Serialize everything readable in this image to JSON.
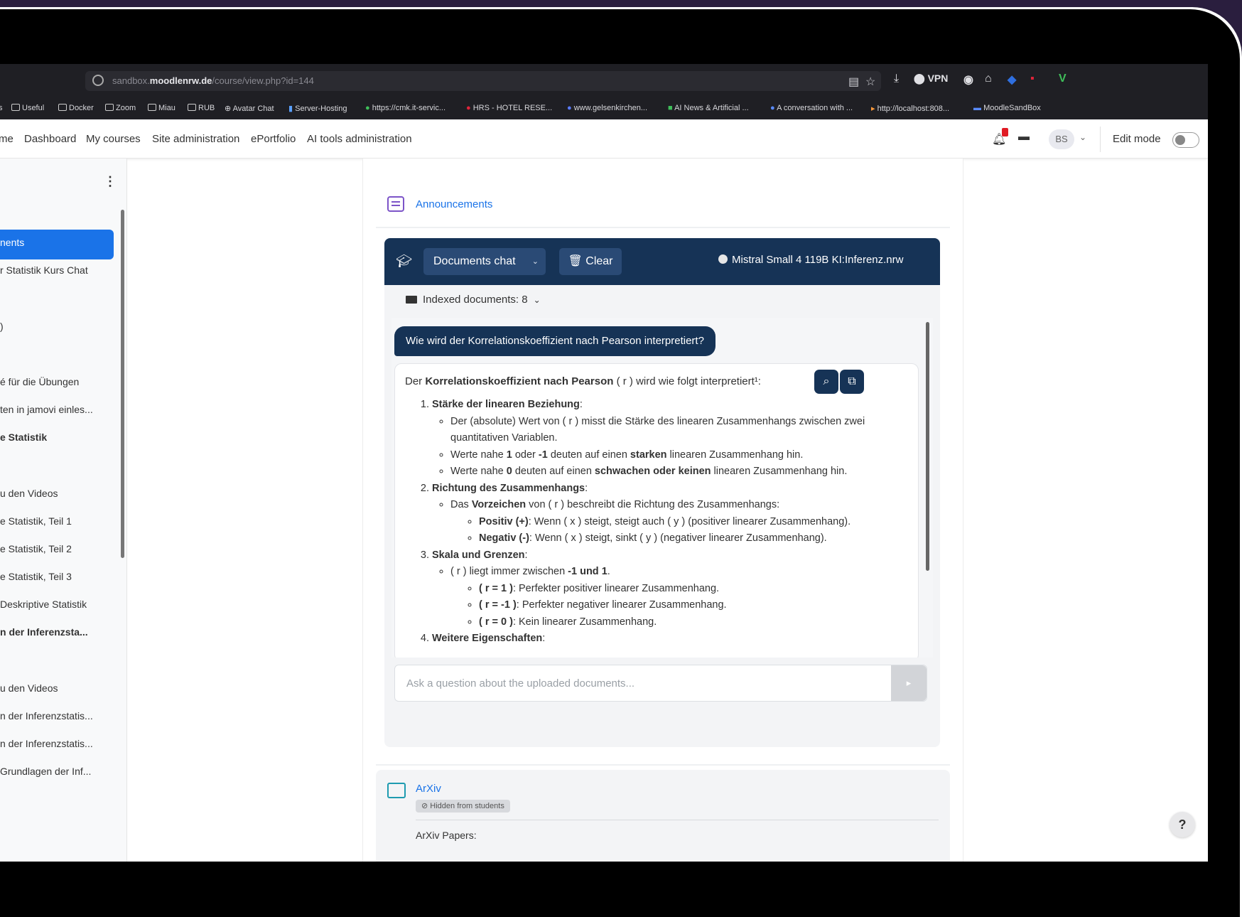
{
  "browser": {
    "url_prefix": "sandbox.",
    "url_domain": "moodlenrw.de",
    "url_path": "/course/view.php?id=144",
    "vpn_label": "VPN",
    "extension_letter": "V",
    "bookmarks": [
      {
        "label": "Useful"
      },
      {
        "label": "Docker"
      },
      {
        "label": "Zoom"
      },
      {
        "label": "Miau"
      },
      {
        "label": "RUB"
      },
      {
        "label": "Avatar Chat"
      },
      {
        "label": "Server-Hosting"
      },
      {
        "label": "https://cmk.it-servic..."
      },
      {
        "label": "HRS - HOTEL RESE..."
      },
      {
        "label": "www.gelsenkirchen..."
      },
      {
        "label": "AI News & Artificial ..."
      },
      {
        "label": "A conversation with ..."
      },
      {
        "label": "http://localhost:808..."
      },
      {
        "label": "MoodleSandBox"
      }
    ]
  },
  "nav": {
    "items": [
      "me",
      "Dashboard",
      "My courses",
      "Site administration",
      "ePortfolio",
      "AI tools administration"
    ],
    "avatar_initials": "BS",
    "edit_mode_label": "Edit mode"
  },
  "sidebar": {
    "items": [
      {
        "label": "nents",
        "active": true,
        "bold": false
      },
      {
        "label": "r Statistik Kurs Chat",
        "bold": false
      },
      {
        "label": ")",
        "bold": false
      },
      {
        "label": "é für die Übungen",
        "bold": false
      },
      {
        "label": "ten in jamovi einles...",
        "bold": false
      },
      {
        "label": "e Statistik",
        "bold": true
      },
      {
        "label": "u den Videos",
        "bold": false
      },
      {
        "label": "e Statistik, Teil 1",
        "bold": false
      },
      {
        "label": "e Statistik, Teil 2",
        "bold": false
      },
      {
        "label": "e Statistik, Teil 3",
        "bold": false
      },
      {
        "label": "Deskriptive Statistik",
        "bold": false
      },
      {
        "label": "n der Inferenzsta...",
        "bold": true
      },
      {
        "label": "u den Videos",
        "bold": false
      },
      {
        "label": "n der Inferenzstatis...",
        "bold": false
      },
      {
        "label": "n der Inferenzstatis...",
        "bold": false
      },
      {
        "label": "Grundlagen der Inf...",
        "bold": false
      }
    ]
  },
  "main": {
    "announcements_label": "Announcements",
    "chat": {
      "mode_label": "Documents chat",
      "clear_label": "Clear",
      "model_label": "Mistral Small 4 119B KI:Inferenz.nrw",
      "indexed_label": "Indexed documents: 8",
      "user_question": "Wie wird der Korrelationskoeffizient nach Pearson interpretiert?",
      "answer": {
        "intro_pre": "Der ",
        "intro_bold": "Korrelationskoeffizient nach Pearson",
        "intro_post": " ( r ) wird wie folgt interpretiert¹:",
        "s1_title": "Stärke der linearen Beziehung",
        "s1_b1": "Der (absolute) Wert von ( r ) misst die Stärke des linearen Zusammenhangs zwischen zwei quantitativen Variablen.",
        "s1_b2_pre": "Werte nahe ",
        "s1_b2_v1": "1",
        "s1_b2_mid": " oder ",
        "s1_b2_v2": "-1",
        "s1_b2_mid2": " deuten auf einen ",
        "s1_b2_strong": "starken",
        "s1_b2_post": " linearen Zusammenhang hin.",
        "s1_b3_pre": "Werte nahe ",
        "s1_b3_v": "0",
        "s1_b3_mid": " deuten auf einen ",
        "s1_b3_strong": "schwachen oder keinen",
        "s1_b3_post": " linearen Zusammenhang hin.",
        "s2_title": "Richtung des Zusammenhangs",
        "s2_b1_pre": "Das ",
        "s2_b1_bold": "Vorzeichen",
        "s2_b1_post": " von ( r ) beschreibt die Richtung des Zusammenhangs:",
        "s2_pos_bold": "Positiv (+)",
        "s2_pos_text": ": Wenn ( x ) steigt, steigt auch ( y ) (positiver linearer Zusammenhang).",
        "s2_neg_bold": "Negativ (-)",
        "s2_neg_text": ": Wenn ( x ) steigt, sinkt ( y ) (negativer linearer Zusammenhang).",
        "s3_title": "Skala und Grenzen",
        "s3_b1_pre": "( r ) liegt immer zwischen ",
        "s3_b1_bold": "-1 und 1",
        "s3_b1_post": ".",
        "s3_c1_bold": "( r = 1 )",
        "s3_c1_text": ": Perfekter positiver linearer Zusammenhang.",
        "s3_c2_bold": "( r = -1 )",
        "s3_c2_text": ": Perfekter negativer linearer Zusammenhang.",
        "s3_c3_bold": "( r = 0 )",
        "s3_c3_text": ": Kein linearer Zusammenhang.",
        "s4_title": "Weitere Eigenschaften"
      },
      "input_placeholder": "Ask a question about the uploaded documents...",
      "send_label": "▸"
    },
    "arxiv": {
      "title": "ArXiv",
      "badge": "Hidden from students",
      "text": "ArXiv Papers:"
    }
  },
  "help_label": "?",
  "colors": {
    "primary": "#163356",
    "accent": "#1a73e8",
    "frame": "#000000",
    "background": "#2a1e3e"
  }
}
